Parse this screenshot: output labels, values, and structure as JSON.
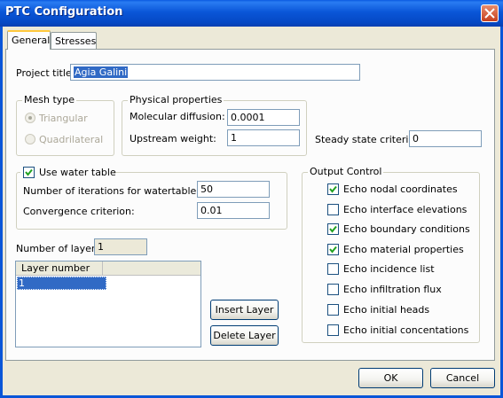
{
  "window": {
    "title": "PTC Configuration"
  },
  "tabs": [
    {
      "label": "General",
      "active": true
    },
    {
      "label": "Stresses",
      "active": false
    }
  ],
  "project": {
    "label": "Project title:",
    "value": "Agia Galini"
  },
  "mesh_type": {
    "legend": "Mesh type",
    "options": [
      {
        "label": "Triangular",
        "selected": true,
        "enabled": false
      },
      {
        "label": "Quadrilateral",
        "selected": false,
        "enabled": false
      }
    ]
  },
  "physical": {
    "legend": "Physical properties",
    "molecular_label": "Molecular diffusion:",
    "molecular_value": "0.0001",
    "upstream_label": "Upstream weight:",
    "upstream_value": "1"
  },
  "steady": {
    "label": "Steady state criterion:",
    "value": "0"
  },
  "water_table": {
    "legend": "Use water table",
    "checked": true,
    "iterations_label": "Number of iterations for watertable:",
    "iterations_value": "50",
    "convergence_label": "Convergence criterion:",
    "convergence_value": "0.01"
  },
  "layers": {
    "label": "Number of layers:",
    "value": "1",
    "column_header": "Layer number",
    "rows": [
      "1"
    ],
    "insert_label": "Insert Layer",
    "delete_label": "Delete Layer"
  },
  "output": {
    "legend": "Output Control",
    "items": [
      {
        "label": "Echo nodal coordinates",
        "checked": true
      },
      {
        "label": "Echo interface elevations",
        "checked": false
      },
      {
        "label": "Echo boundary conditions",
        "checked": true
      },
      {
        "label": "Echo material properties",
        "checked": true
      },
      {
        "label": "Echo incidence list",
        "checked": false
      },
      {
        "label": "Echo infiltration flux",
        "checked": false
      },
      {
        "label": "Echo initial heads",
        "checked": false
      },
      {
        "label": "Echo initial concentations",
        "checked": false
      }
    ]
  },
  "footer": {
    "ok_label": "OK",
    "cancel_label": "Cancel"
  },
  "colors": {
    "titlebar": "#0a56d8",
    "selection": "#316ac5",
    "dialog": "#ece9d8"
  }
}
